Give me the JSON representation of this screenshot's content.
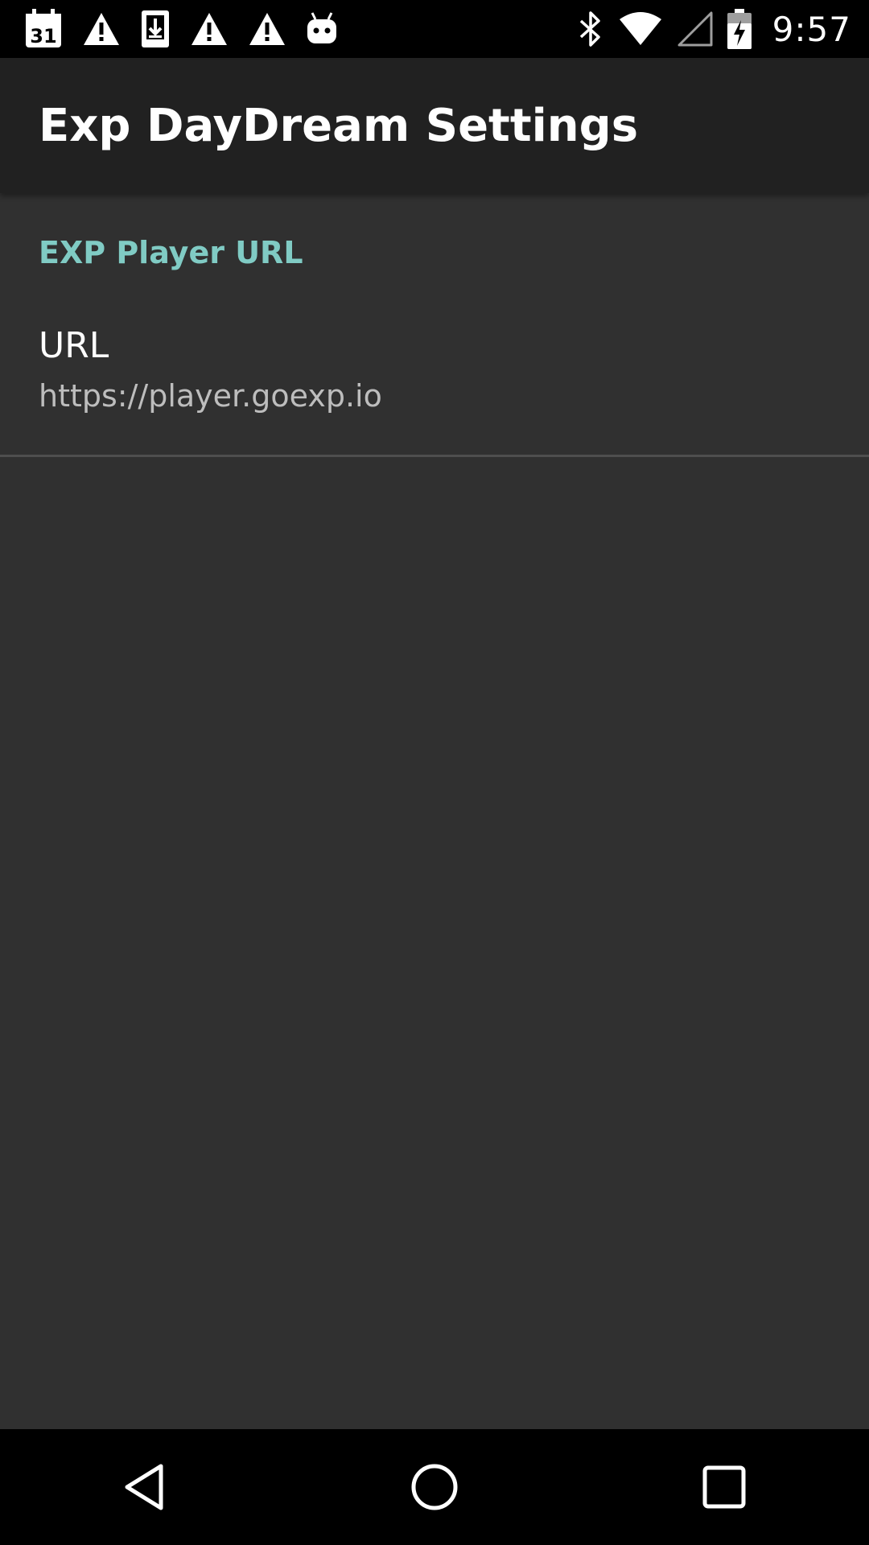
{
  "status_bar": {
    "time": "9:57",
    "calendar_day": "31",
    "left_icons": [
      "calendar-icon",
      "warning-icon",
      "download-icon",
      "warning-icon",
      "warning-icon",
      "android-icon"
    ],
    "right_icons": [
      "bluetooth-icon",
      "wifi-icon",
      "signal-icon",
      "battery-charging-icon"
    ]
  },
  "app_bar": {
    "title": "Exp DayDream Settings"
  },
  "preferences": {
    "category": "EXP Player URL",
    "items": [
      {
        "title": "URL",
        "summary": "https://player.goexp.io"
      }
    ]
  },
  "nav_bar": {
    "buttons": [
      "back-icon",
      "home-icon",
      "recents-icon"
    ]
  },
  "colors": {
    "accent": "#80CBC4",
    "background": "#303030",
    "app_bar": "#212121"
  }
}
